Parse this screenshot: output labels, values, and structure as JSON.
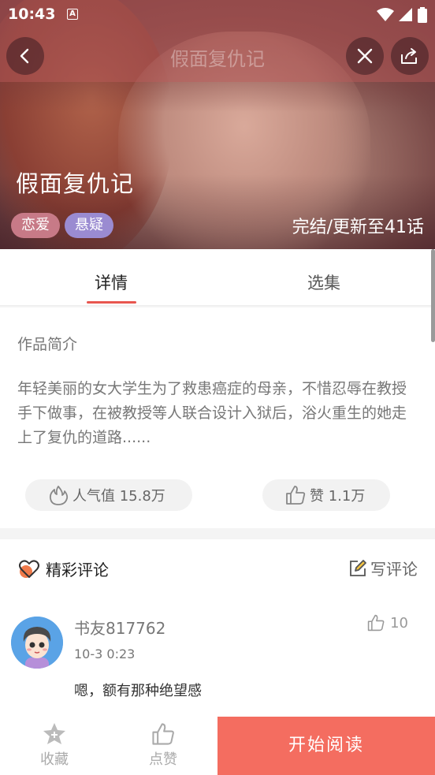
{
  "status_bar": {
    "time": "10:43",
    "notification_icon_letter": "A"
  },
  "nav": {
    "title": "假面复仇记"
  },
  "hero": {
    "title": "假面复仇记",
    "tags": [
      "恋爱",
      "悬疑"
    ],
    "update_status": "完结/更新至41话"
  },
  "tabs": [
    {
      "label": "详情",
      "active": true
    },
    {
      "label": "选集",
      "active": false
    }
  ],
  "intro": {
    "heading": "作品简介",
    "text": "年轻美丽的女大学生为了救患癌症的母亲，不惜忍辱在教授手下做事，在被教授等人联合设计入狱后，浴火重生的她走上了复仇的道路......",
    "popularity_label": "人气值 15.8万",
    "likes_label": "赞 1.1万"
  },
  "comments": {
    "heading": "精彩评论",
    "write_label": "写评论",
    "items": [
      {
        "user": "书友817762",
        "time": "10-3 0:23",
        "text": "嗯，额有那种绝望感",
        "likes": "10"
      }
    ]
  },
  "bottom_bar": {
    "favorite_label": "收藏",
    "like_label": "点赞",
    "read_label": "开始阅读"
  },
  "colors": {
    "accent": "#f46d60",
    "tab_indicator": "#e8564f",
    "tag_romance": "#c77a87",
    "tag_mystery": "#9a8bd1"
  }
}
